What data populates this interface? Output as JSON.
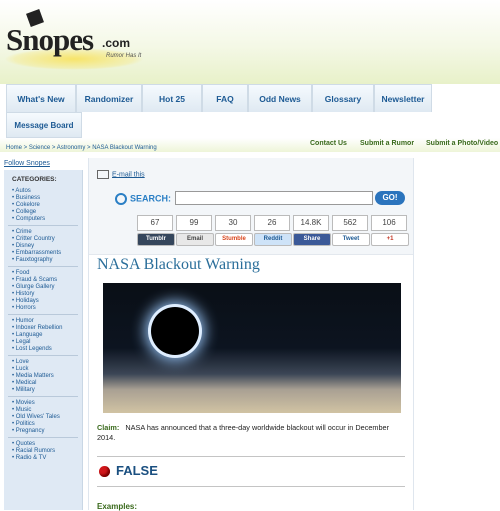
{
  "logo": {
    "word": "Snopes",
    "com": ".com",
    "tagline": "Rumor Has It"
  },
  "nav": {
    "tabs": [
      "What's New",
      "Randomizer",
      "Hot 25",
      "FAQ",
      "Odd News",
      "Glossary",
      "Newsletter"
    ],
    "row2": [
      "Message Board"
    ],
    "right_links": [
      "Contact Us",
      "Submit a Rumor",
      "Submit a Photo/Video"
    ]
  },
  "breadcrumb": "Home > Science > Astronomy > NASA Blackout Warning",
  "sidebar": {
    "follow": "Follow Snopes",
    "heading": "CATEGORIES:",
    "groups": [
      [
        "Autos",
        "Business",
        "Cokelore",
        "College",
        "Computers"
      ],
      [
        "Crime",
        "Critter Country",
        "Disney",
        "Embarrassments",
        "Fauxtography"
      ],
      [
        "Food",
        "Fraud & Scams",
        "Glurge Gallery",
        "History",
        "Holidays",
        "Horrors"
      ],
      [
        "Humor",
        "Inboxer Rebellion",
        "Language",
        "Legal",
        "Lost Legends"
      ],
      [
        "Love",
        "Luck",
        "Media Matters",
        "Medical",
        "Military"
      ],
      [
        "Movies",
        "Music",
        "Old Wives' Tales",
        "Politics",
        "Pregnancy"
      ],
      [
        "Quotes",
        "Racial Rumors",
        "Radio & TV"
      ]
    ]
  },
  "share": {
    "email": "E-mail this",
    "search_label": "SEARCH:",
    "search_value": "",
    "go": "GO!",
    "counts": [
      "67",
      "99",
      "30",
      "26",
      "14.8K",
      "562",
      "106"
    ],
    "buttons": [
      "Tumblr",
      "Email",
      "Stumble",
      "Reddit",
      "Share",
      "Tweet",
      "+1"
    ],
    "button_colors": [
      "#35465c",
      "#e8e8e8",
      "#ffffff",
      "#cee3f8",
      "#3b5998",
      "#ffffff",
      "#ffffff"
    ]
  },
  "article": {
    "title": "NASA Blackout Warning",
    "claim_label": "Claim:",
    "claim_text": "NASA has announced that a three-day worldwide blackout will occur in December 2014.",
    "status": "FALSE",
    "examples_label": "Examples:"
  }
}
